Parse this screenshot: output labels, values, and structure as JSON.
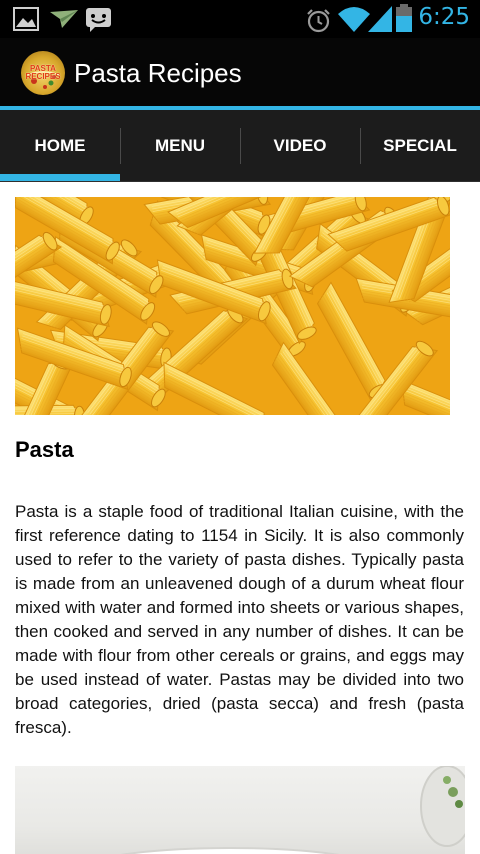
{
  "status_bar": {
    "time": "6:25",
    "icons": [
      "gallery-icon",
      "send-icon",
      "chat-icon",
      "alarm-icon",
      "wifi-icon",
      "signal-icon",
      "battery-icon"
    ]
  },
  "action_bar": {
    "logo_text": "PASTA RECIPES",
    "title": "Pasta Recipes"
  },
  "tabs": [
    {
      "label": "HOME",
      "selected": true
    },
    {
      "label": "MENU",
      "selected": false
    },
    {
      "label": "VIDEO",
      "selected": false
    },
    {
      "label": "SPECIAL",
      "selected": false
    }
  ],
  "article": {
    "title": "Pasta",
    "body": "Pasta is a staple food of traditional Italian cuisine, with the first reference dating to 1154 in Sicily. It is also commonly used to refer to the variety of pasta dishes. Typically pasta is made from an unleavened dough of a durum wheat flour mixed with water and formed into sheets or various shapes, then cooked and served in any number of dishes. It can be made with flour from other cereals or grains, and eggs may be used instead of water. Pastas may be divided into two broad categories, dried (pasta secca) and fresh (pasta fresca)."
  },
  "colors": {
    "accent": "#33b5e5",
    "status_bar": "#000000",
    "action_bar": "#060606",
    "tab_bar": "#1c1c1c",
    "pasta": "#f3b92a"
  }
}
